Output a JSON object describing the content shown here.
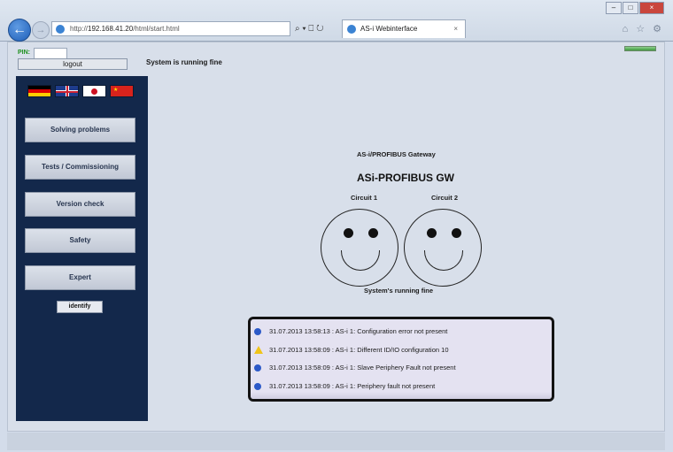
{
  "browser": {
    "url_prefix": "http://",
    "url_host": "192.168.41.20",
    "url_path": "/html/start.html",
    "address_tools": "⌕ ▾ ⎕ ↻",
    "tab_title": "AS-i Webinterface",
    "tab_close": "×",
    "window_buttons": [
      "–",
      "□",
      "×"
    ],
    "command_icons": "⌂ ☆ ⚙"
  },
  "header": {
    "pin_label": "PIN:",
    "logout_label": "logout",
    "status_text": "System is running fine"
  },
  "sidebar": {
    "flags": [
      "de",
      "uk",
      "jp",
      "cn"
    ],
    "menu": [
      {
        "label": "Solving problems"
      },
      {
        "label": "Tests / Commissioning"
      },
      {
        "label": "Version check"
      },
      {
        "label": "Safety"
      },
      {
        "label": "Expert"
      }
    ],
    "identify_label": "identify"
  },
  "main": {
    "gateway_type": "AS-i/PROFIBUS Gateway",
    "gateway_name": "ASi-PROFIBUS GW",
    "circuits": [
      {
        "label": "Circuit 1",
        "state": "happy"
      },
      {
        "label": "Circuit 2",
        "state": "happy"
      }
    ],
    "system_status": "System's running fine"
  },
  "log": [
    {
      "icon": "info",
      "text": "31.07.2013 13:58:13 : AS-i 1: Configuration error not present"
    },
    {
      "icon": "warning",
      "text": "31.07.2013 13:58:09 : AS-i 1: Different ID/IO configuration 10"
    },
    {
      "icon": "info",
      "text": "31.07.2013 13:58:09 : AS-i 1: Slave Periphery Fault not present"
    },
    {
      "icon": "info",
      "text": "31.07.2013 13:58:09 : AS-i 1: Periphery fault not present"
    }
  ],
  "colors": {
    "sidebar_bg": "#13284b",
    "status_led": "#3f9a3f",
    "info_icon": "#2c59c8",
    "warning_icon": "#f0c419"
  }
}
